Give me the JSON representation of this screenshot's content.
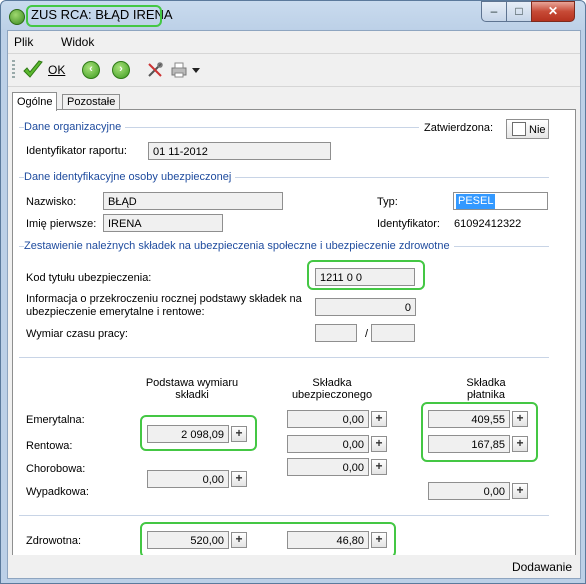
{
  "window": {
    "title": "ZUS RCA: BŁĄD IRENA",
    "minimize": "–",
    "maximize": "□",
    "close": "✕"
  },
  "menu": {
    "items": [
      {
        "label": "Plik"
      },
      {
        "label": "Widok"
      }
    ]
  },
  "toolbar": {
    "ok_label": "OK",
    "icons": [
      "ok-check-icon",
      "back-arrow-icon",
      "forward-arrow-icon",
      "tools-icon",
      "printer-icon",
      "dropdown-arrow-icon"
    ]
  },
  "tabs": [
    {
      "label": "Ogólne",
      "active": true
    },
    {
      "label": "Pozostałe",
      "active": false
    }
  ],
  "org": {
    "section": "Dane organizacyjne",
    "confirmed_label": "Zatwierdzona:",
    "confirmed_value": "Nie",
    "report_id_label": "Identyfikator raportu:",
    "report_id_value": "01 11-2012"
  },
  "person": {
    "section": "Dane identyfikacyjne osoby ubezpieczonej",
    "surname_label": "Nazwisko:",
    "surname_value": "BŁĄD",
    "firstname_label": "Imię pierwsze:",
    "firstname_value": "IRENA",
    "type_label": "Typ:",
    "type_value": "PESEL",
    "id_label": "Identyfikator:",
    "id_value": "61092412322"
  },
  "contrib": {
    "section": "Zestawienie należnych składek na ubezpieczenia społeczne i ubezpieczenie zdrowotne",
    "code_label": "Kod tytułu ubezpieczenia:",
    "code_value": "1211 0 0",
    "excess_label_1": "Informacja o przekroczeniu rocznej podstawy składek na",
    "excess_label_2": "ubezpieczenie emerytalne i rentowe:",
    "excess_value": "0",
    "worktime_label": "Wymiar czasu pracy:",
    "worktime_sep": "/"
  },
  "table": {
    "col_base": [
      "Podstawa wymiaru",
      "składki"
    ],
    "col_insured": [
      "Składka",
      "ubezpieczonego"
    ],
    "col_payer": [
      "Składka",
      "płatnika"
    ],
    "rows": {
      "emerytalna": {
        "label": "Emerytalna:",
        "base": "2 098,09",
        "insured": "0,00",
        "payer": "409,55"
      },
      "rentowa": {
        "label": "Rentowa:",
        "insured": "0,00",
        "payer": "167,85"
      },
      "chorobowa": {
        "label": "Chorobowa:",
        "base": "0,00",
        "insured": "0,00"
      },
      "wypadkowa": {
        "label": "Wypadkowa:",
        "payer": "0,00"
      }
    },
    "health": {
      "label": "Zdrowotna:",
      "base": "520,00",
      "insured": "46,80"
    },
    "plus": "+"
  },
  "status": {
    "mode": "Dodawanie"
  }
}
